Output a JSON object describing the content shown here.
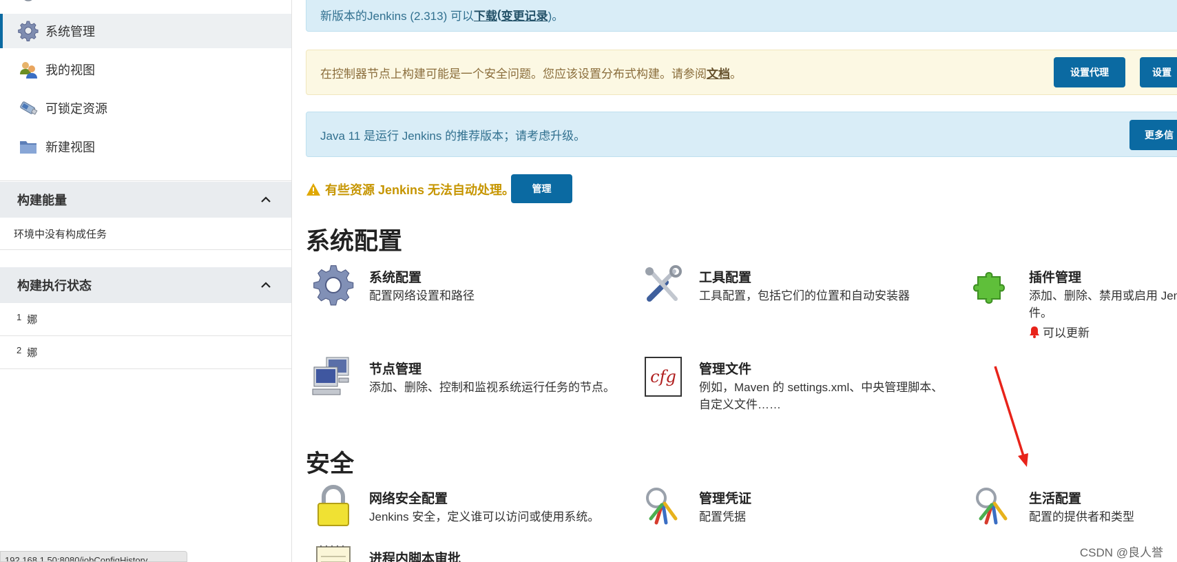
{
  "sidebar": {
    "nav": [
      {
        "label": "系统管理",
        "icon": "gear-icon"
      },
      {
        "label": "我的视图",
        "icon": "users-icon"
      },
      {
        "label": "可锁定资源",
        "icon": "usb-drive-icon"
      },
      {
        "label": "新建视图",
        "icon": "folder-icon"
      }
    ],
    "build_queue": {
      "title": "构建能量",
      "empty_text": "环境中没有构成任务"
    },
    "executors": {
      "title": "构建执行状态",
      "rows": [
        {
          "num": "1",
          "label": "娜"
        },
        {
          "num": "2",
          "label": "娜"
        }
      ]
    },
    "status_url": "192.168.1.50:8080/jobConfigHistory"
  },
  "alerts": {
    "update": {
      "text": "新版本的Jenkins (2.313) 可以",
      "download": "下载",
      "paren_open": "(",
      "changelog": "变更记录",
      "paren_close": ")。"
    },
    "security": {
      "text": "在控制器节点上构建可能是一个安全问题。您应该设置分布式构建。请参阅",
      "doc_link": "文档",
      "end": "。",
      "btn1": "设置代理",
      "btn2": "设置"
    },
    "java": {
      "text": "Java 11 是运行 Jenkins 的推荐版本；请考虑升级。",
      "btn": "更多信"
    }
  },
  "warning": {
    "text": "有些资源 Jenkins 无法自动处理。",
    "btn": "管理"
  },
  "sections": {
    "system": {
      "title": "系统配置",
      "items": [
        {
          "title": "系统配置",
          "desc": "配置网络设置和路径"
        },
        {
          "title": "工具配置",
          "desc": "工具配置，包括它们的位置和自动安装器"
        },
        {
          "title": "插件管理",
          "desc": "添加、删除、禁用或启用 Jen",
          "desc2": "件。",
          "note": "可以更新"
        },
        {
          "title": "节点管理",
          "desc": "添加、删除、控制和监视系统运行任务的节点。"
        },
        {
          "title": "管理文件",
          "desc": "例如，Maven 的 settings.xml、中央管理脚本、",
          "desc2": "自定义文件……"
        }
      ]
    },
    "security": {
      "title": "安全",
      "items": [
        {
          "title": "网络安全配置",
          "desc": "Jenkins 安全，定义谁可以访问或使用系统。"
        },
        {
          "title": "管理凭证",
          "desc": "配置凭据"
        },
        {
          "title": "生活配置",
          "desc": "配置的提供者和类型"
        },
        {
          "title": "进程内脚本审批",
          "desc": ""
        }
      ]
    }
  },
  "watermark": "CSDN @良人誉",
  "colors": {
    "accent": "#0b6aa2",
    "info_bg": "#d9edf7",
    "warn_bg": "#fcf8e3",
    "warn_text": "#c69500",
    "arrow": "#e8231a"
  }
}
